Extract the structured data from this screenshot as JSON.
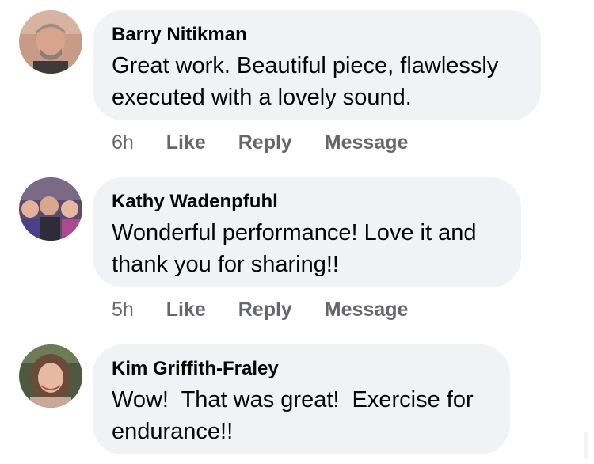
{
  "comments": [
    {
      "author": "Barry Nitikman",
      "text": "Great work. Beautiful piece, flawlessly executed with a lovely sound.",
      "time": "6h",
      "like_label": "Like",
      "reply_label": "Reply",
      "message_label": "Message"
    },
    {
      "author": "Kathy Wadenpfuhl",
      "text": "Wonderful performance! Love it and thank you for sharing!!",
      "time": "5h",
      "like_label": "Like",
      "reply_label": "Reply",
      "message_label": "Message"
    },
    {
      "author": "Kim Griffith-Fraley",
      "text": "Wow!  That was great!  Exercise for endurance!!"
    }
  ],
  "colors": {
    "bubble": "#f0f2f5",
    "meta_text": "#65676b",
    "primary_text": "#050505"
  }
}
